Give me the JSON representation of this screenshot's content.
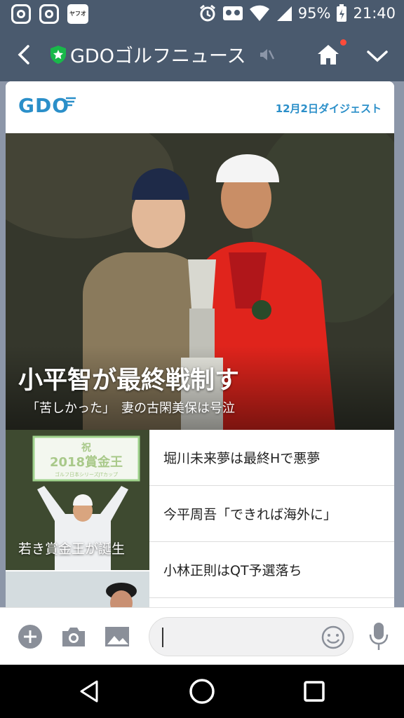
{
  "status_bar": {
    "app_badge": "ヤフオク!",
    "battery_percent": "95%",
    "time": "21:40"
  },
  "header": {
    "title": "GDOゴルフニュース"
  },
  "card": {
    "logo": "GDO",
    "digest_date": "12月2日ダイジェスト",
    "hero": {
      "title": "小平智が最終戦制す",
      "subtitle": "「苦しかった」　妻の古閑美保は号泣"
    },
    "thumb": {
      "sign_line1": "祝",
      "sign_line2": "2018賞金王",
      "sign_line3": "ゴルフ日本シリーズJTカップ",
      "caption": "若き賞金王が誕生"
    },
    "list": [
      {
        "label": "堀川未来夢は最終Hで悪夢"
      },
      {
        "label": "今平周吾「できれば海外に」"
      },
      {
        "label": "小林正則はQT予選落ち"
      }
    ]
  },
  "colors": {
    "header_bg": "#4a5a6e",
    "chat_bg": "#8c96a8",
    "accent_blue": "#2b8fc9",
    "verified_green": "#19b84a",
    "notification": "#ff4b3a"
  }
}
